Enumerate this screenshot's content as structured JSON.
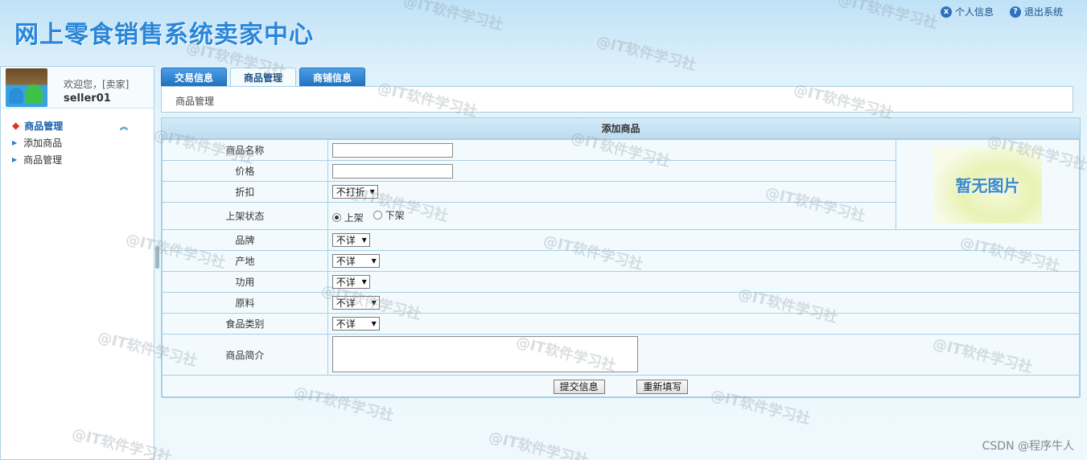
{
  "header": {
    "title": "网上零食销售系统卖家中心",
    "links": [
      {
        "icon": "x-circle-icon",
        "glyph": "x",
        "label": "个人信息"
      },
      {
        "icon": "question-circle-icon",
        "glyph": "?",
        "label": "退出系统"
      }
    ]
  },
  "sidebar": {
    "welcome": "欢迎您，[卖家]",
    "username": "seller01",
    "menu_title": "商品管理",
    "items": [
      {
        "label": "添加商品"
      },
      {
        "label": "商品管理"
      }
    ]
  },
  "tabs": [
    {
      "label": "交易信息",
      "active": false
    },
    {
      "label": "商品管理",
      "active": true
    },
    {
      "label": "商铺信息",
      "active": false
    }
  ],
  "breadcrumb": "商品管理",
  "form": {
    "title": "添加商品",
    "fields": {
      "name": {
        "label": "商品名称",
        "value": ""
      },
      "price": {
        "label": "价格",
        "value": ""
      },
      "discount": {
        "label": "折扣",
        "selected": "不打折"
      },
      "status": {
        "label": "上架状态",
        "options": [
          "上架",
          "下架"
        ],
        "selected": "上架"
      },
      "brand": {
        "label": "品牌",
        "selected": "不详"
      },
      "origin": {
        "label": "产地",
        "selected": "不详"
      },
      "effect": {
        "label": "功用",
        "selected": "不详"
      },
      "material": {
        "label": "原料",
        "selected": "不详"
      },
      "category": {
        "label": "食品类别",
        "selected": "不详"
      },
      "intro": {
        "label": "商品简介",
        "value": ""
      }
    },
    "no_image": "暂无图片",
    "submit": "提交信息",
    "reset": "重新填写"
  },
  "watermark": "@IT软件学习社",
  "credit": "CSDN @程序牛人"
}
